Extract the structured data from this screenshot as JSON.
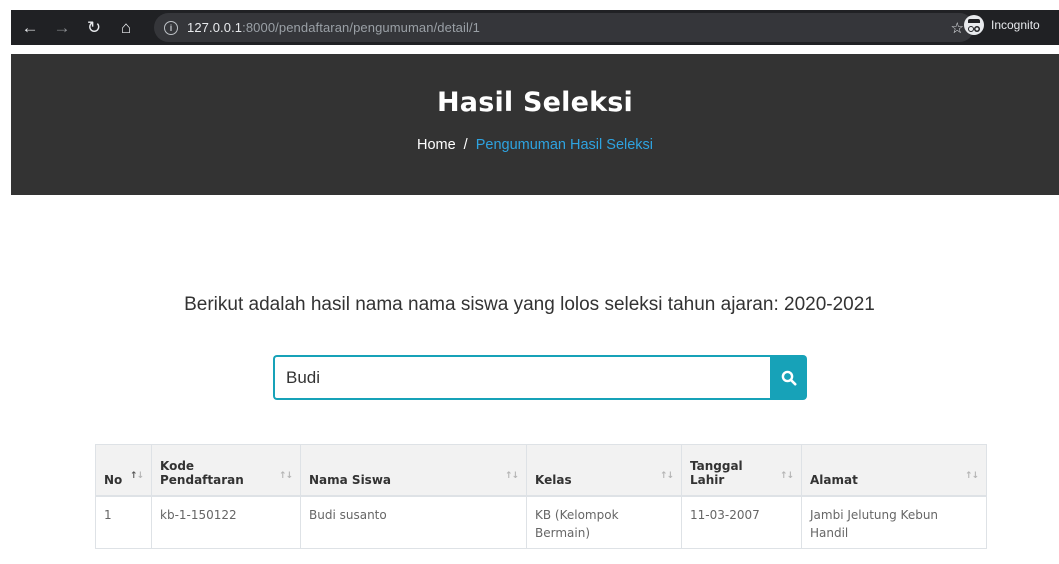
{
  "browser": {
    "url_host": "127.0.0.1",
    "url_rest": ":8000/pendaftaran/pengumuman/detail/1",
    "incognito_label": "Incognito"
  },
  "hero": {
    "title": "Hasil Seleksi",
    "breadcrumb": {
      "home": "Home",
      "separator": "/",
      "current": "Pengumuman Hasil Seleksi"
    }
  },
  "intro": "Berikut adalah hasil nama nama siswa yang lolos seleksi tahun ajaran: 2020-2021",
  "search": {
    "value": "Budi",
    "icon": "search-icon"
  },
  "table": {
    "columns": {
      "no": "No",
      "kode_line1": "Kode",
      "kode_line2": "Pendaftaran",
      "nama": "Nama Siswa",
      "kelas": "Kelas",
      "tanggal_line1": "Tanggal",
      "tanggal_line2": "Lahir",
      "alamat": "Alamat"
    },
    "rows": [
      {
        "no": "1",
        "kode": "kb-1-150122",
        "nama": "Budi susanto",
        "kelas_line1": "KB (Kelompok",
        "kelas_line2": "Bermain)",
        "tanggal": "11-03-2007",
        "alamat_line1": "Jambi Jelutung Kebun",
        "alamat_line2": "Handil"
      }
    ]
  },
  "colors": {
    "hero_bg": "#333333",
    "accent": "#17a2b8",
    "breadcrumb_active": "#2ea3e0"
  }
}
